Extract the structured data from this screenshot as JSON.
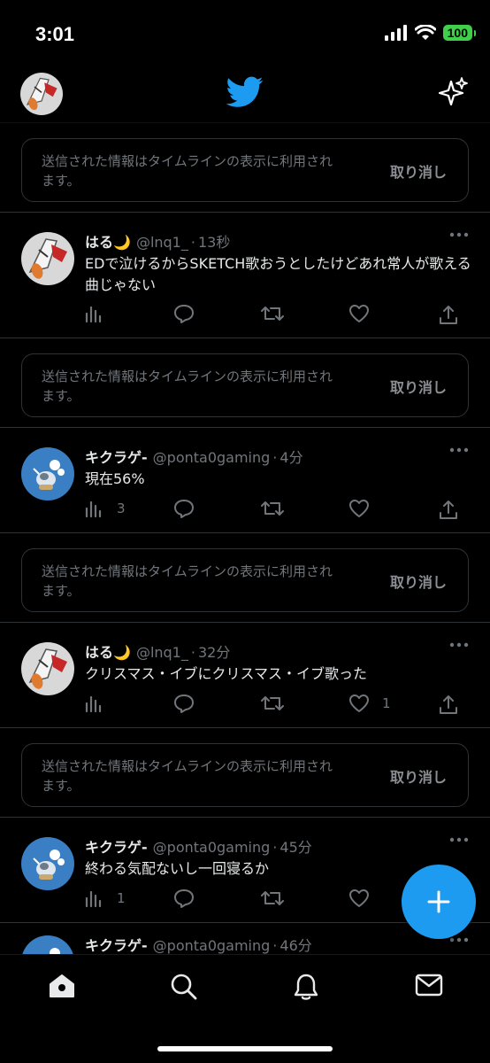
{
  "status_bar": {
    "time": "3:01",
    "battery": "100"
  },
  "notice": {
    "text": "送信された情報はタイムラインの表示に利用されます。",
    "undo_label": "取り消し"
  },
  "tweets": [
    {
      "name": "はる🌙",
      "handle": "@lnq1_",
      "time": "13秒",
      "text": "EDで泣けるからSKETCH歌おうとしたけどあれ常人が歌える曲じゃない",
      "views": "",
      "likes": "",
      "avatar": "sketch"
    },
    {
      "name": "キクラゲ-",
      "handle": "@ponta0gaming",
      "time": "4分",
      "text": "現在56%",
      "views": "3",
      "likes": "",
      "avatar": "cartoon"
    },
    {
      "name": "はる🌙",
      "handle": "@lnq1_",
      "time": "32分",
      "text": "クリスマス・イブにクリスマス・イブ歌った",
      "views": "",
      "likes": "1",
      "avatar": "sketch"
    },
    {
      "name": "キクラゲ-",
      "handle": "@ponta0gaming",
      "time": "45分",
      "text": "終わる気配ないし一回寝るか",
      "views": "1",
      "likes": "",
      "avatar": "cartoon"
    },
    {
      "name": "キクラゲ-",
      "handle": "@ponta0gaming",
      "time": "46分",
      "text": "",
      "views": "",
      "likes": "",
      "avatar": "cartoon"
    }
  ],
  "nav": {
    "items": [
      "home-icon",
      "search-icon",
      "bell-icon",
      "mail-icon"
    ]
  },
  "colors": {
    "accent": "#1d9bf0",
    "background": "#000000",
    "muted": "#71767b",
    "border": "#2f3336"
  }
}
